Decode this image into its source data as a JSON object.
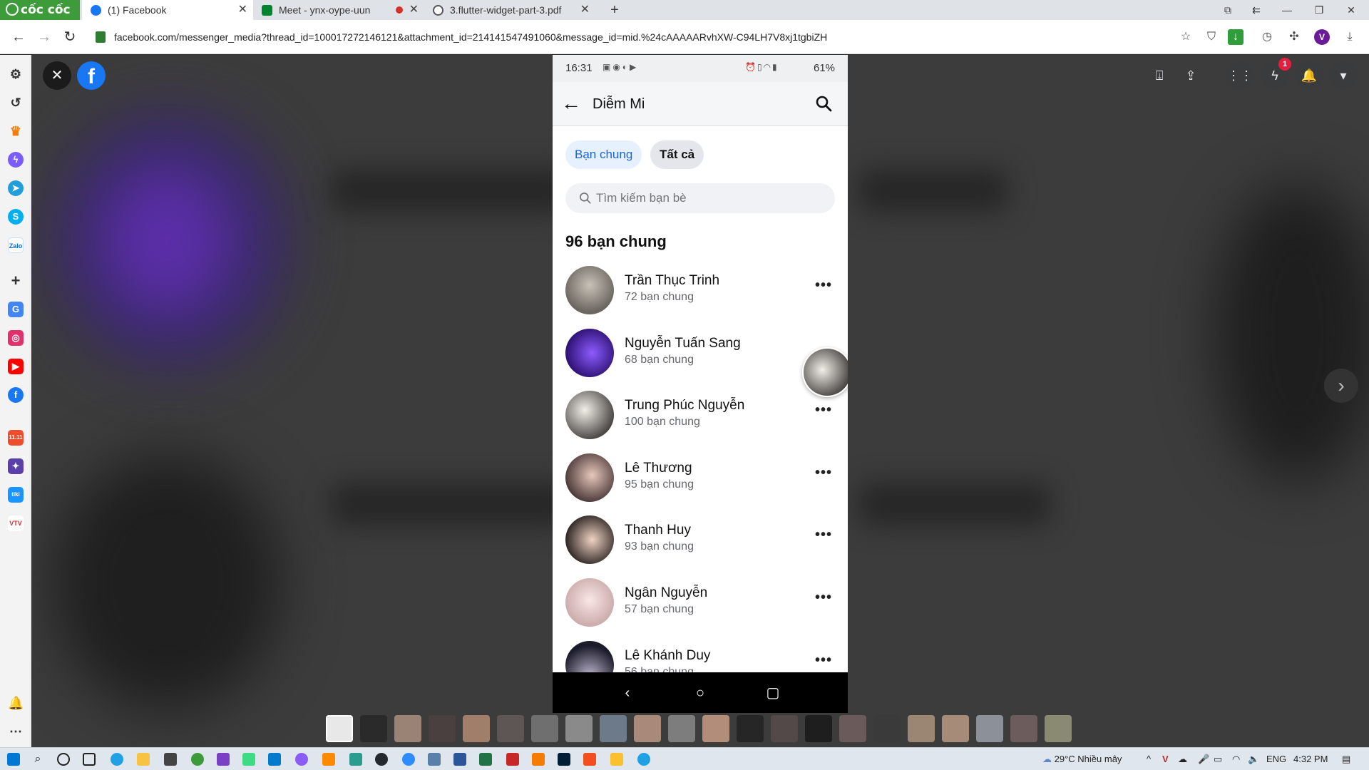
{
  "browser": {
    "brand": "cốc cốc",
    "tabs": [
      {
        "title": "(1) Facebook",
        "active": true,
        "icon": "facebook-icon"
      },
      {
        "title": "Meet - ynx-oype-uun",
        "active": false,
        "icon": "google-meet-icon",
        "recording": true
      },
      {
        "title": "3.flutter-widget-part-3.pdf",
        "active": false,
        "icon": "globe-icon"
      }
    ],
    "url": "facebook.com/messenger_media?thread_id=100017272146121&attachment_id=214141547491060&message_id=mid.%24cAAAAARvhXW-C94LH7V8xj1tgbiZH",
    "profile_initial": "V"
  },
  "viewer": {
    "messenger_badge": "1"
  },
  "phone": {
    "time": "16:31",
    "battery": "61%",
    "header_title": "Diễm Mi",
    "chips": [
      "Bạn chung",
      "Tất cả"
    ],
    "search_placeholder": "Tìm kiếm bạn bè",
    "section_title": "96 bạn chung",
    "friends": [
      {
        "name": "Trần Thục Trinh",
        "mutual": "72 bạn chung"
      },
      {
        "name": "Nguyễn Tuấn Sang",
        "mutual": "68 bạn chung"
      },
      {
        "name": "Trung Phúc Nguyễn",
        "mutual": "100 bạn chung"
      },
      {
        "name": "Lê Thương",
        "mutual": "95 bạn chung"
      },
      {
        "name": "Thanh Huy",
        "mutual": "93 bạn chung"
      },
      {
        "name": "Ngân Nguyễn",
        "mutual": "57 bạn chung"
      },
      {
        "name": "Lê Khánh Duy",
        "mutual": "56 bạn chung"
      }
    ]
  },
  "taskbar": {
    "weather": "29°C  Nhiều mây",
    "language": "ENG",
    "clock": "4:32 PM"
  },
  "colors": {
    "facebook_blue": "#1877f2",
    "chip_active_bg": "#e7f0fd",
    "chip_active_text": "#1a66d6",
    "coccoc_green": "#3d9b3a",
    "badge_red": "#e41e3f"
  }
}
